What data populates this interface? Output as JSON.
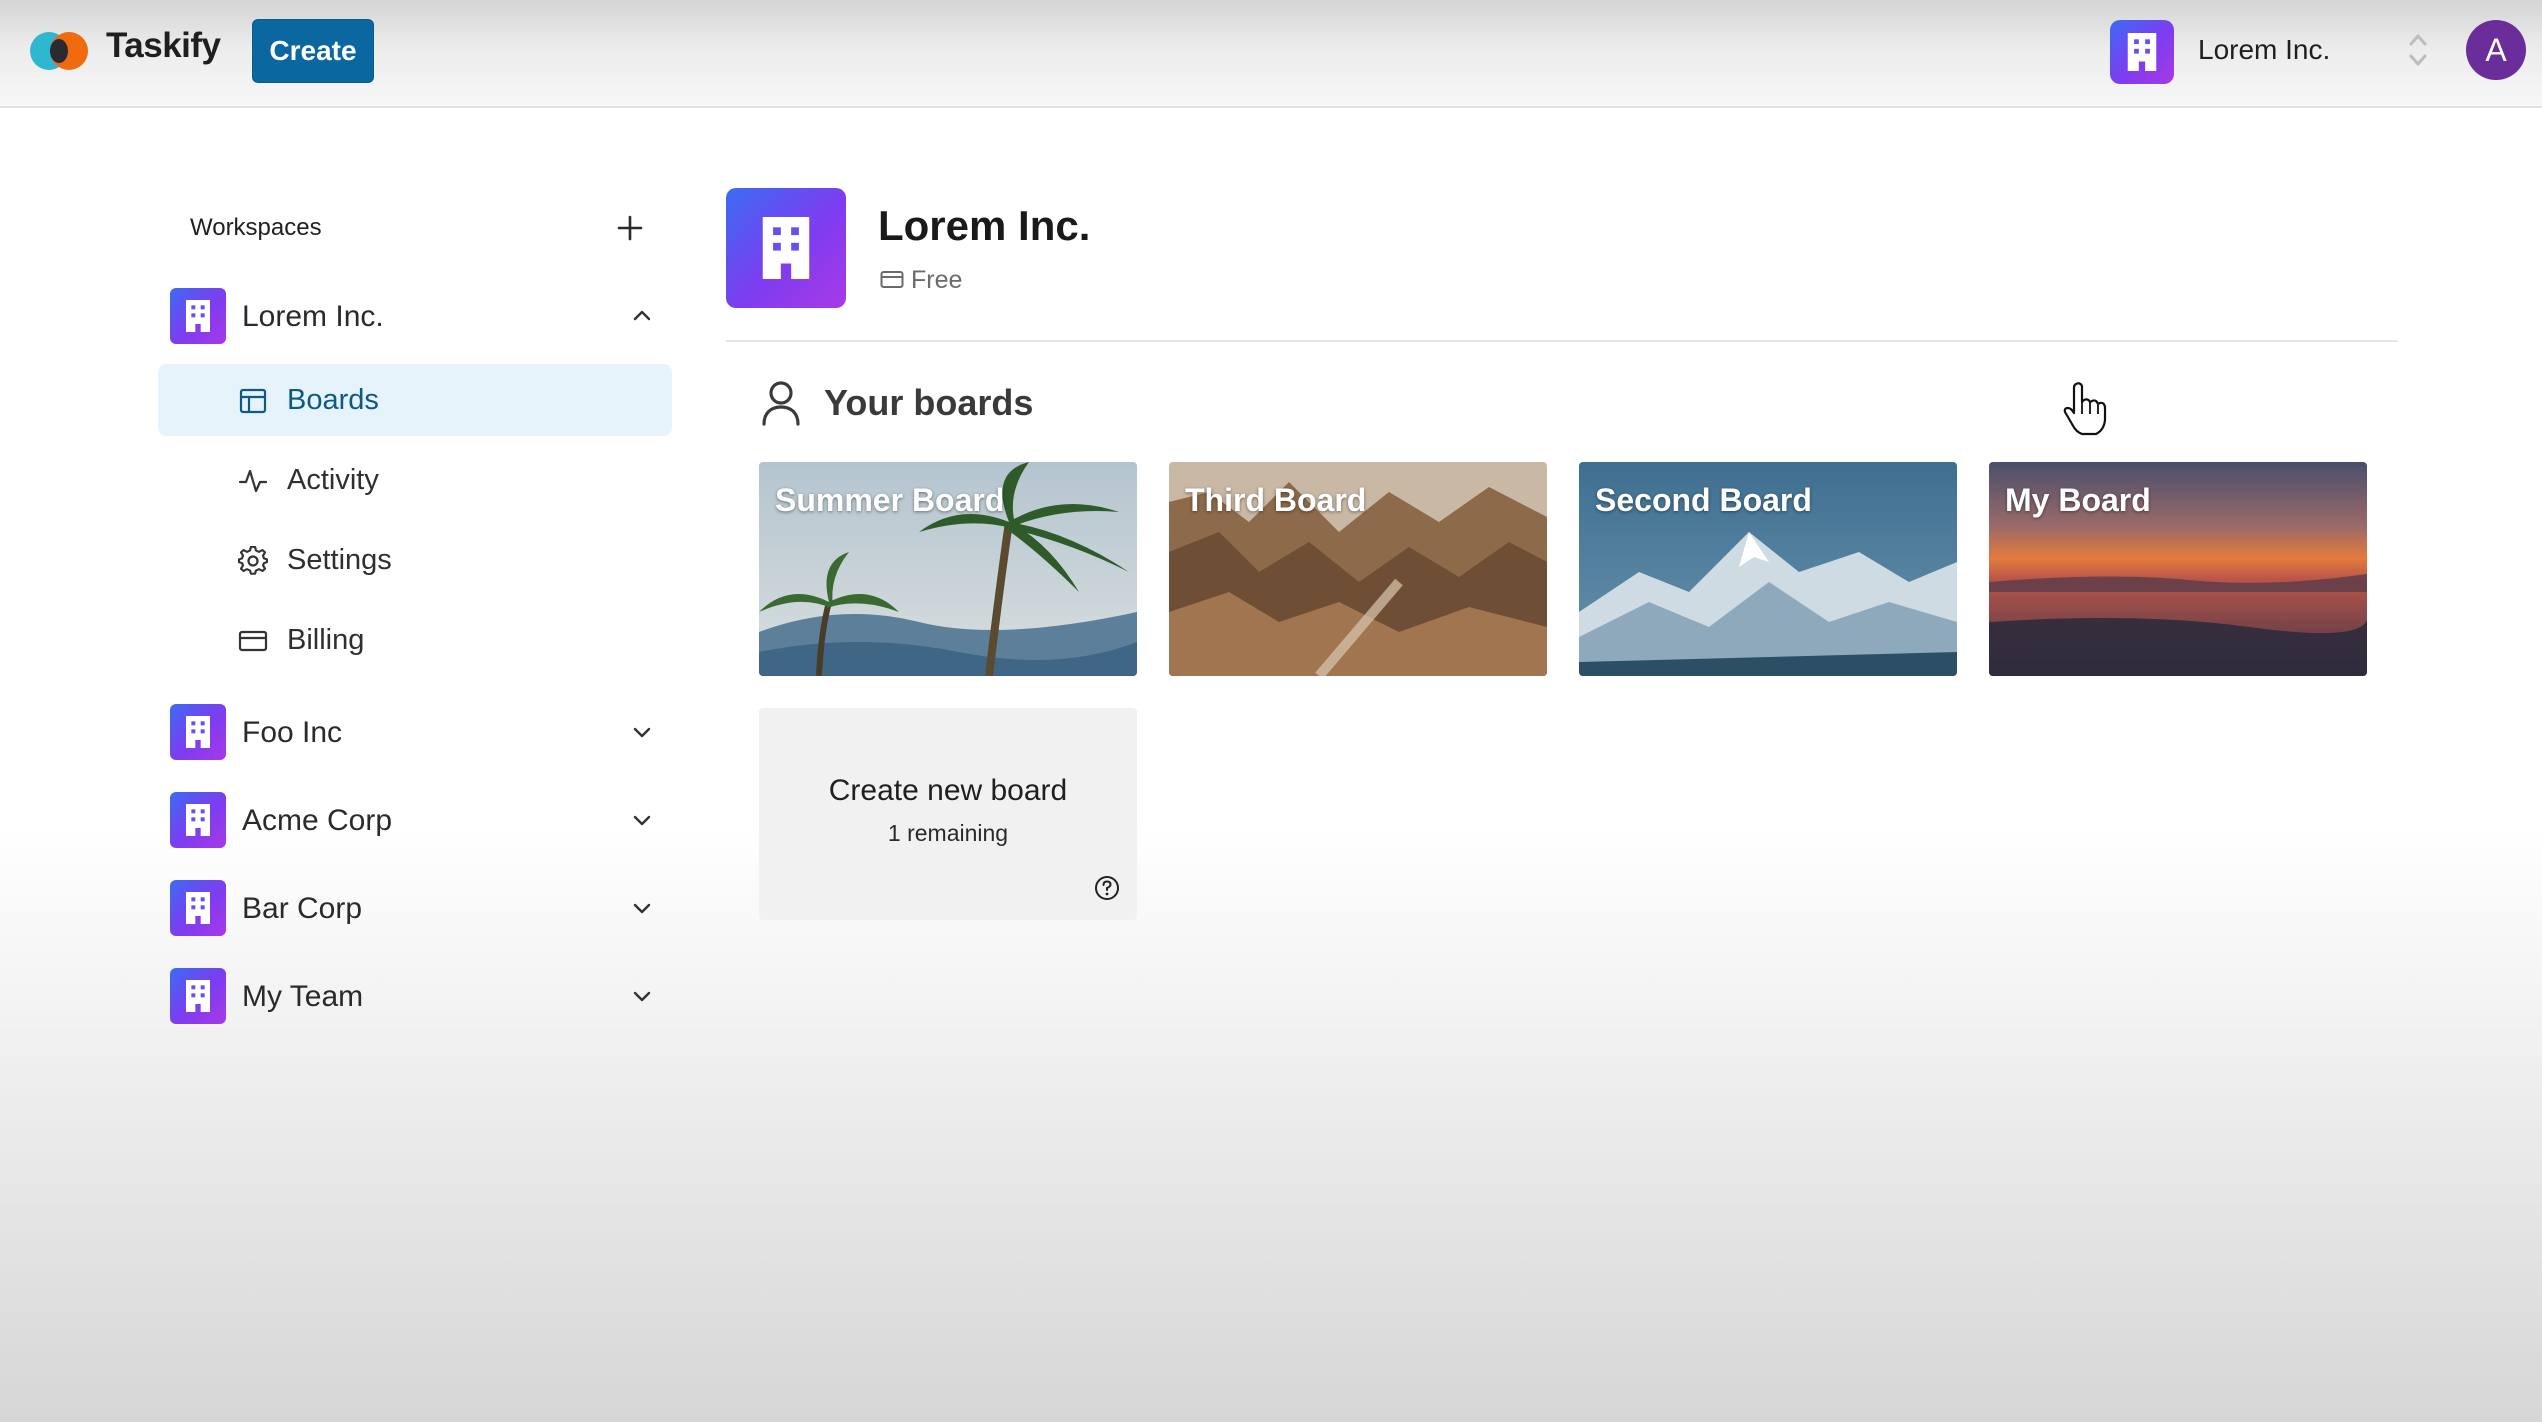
{
  "header": {
    "brand": "Taskify",
    "create_label": "Create",
    "org_name": "Lorem Inc.",
    "avatar_initial": "A"
  },
  "sidebar": {
    "heading": "Workspaces",
    "workspaces": [
      {
        "label": "Lorem Inc.",
        "expanded": true
      },
      {
        "label": "Foo Inc",
        "expanded": false
      },
      {
        "label": "Acme Corp",
        "expanded": false
      },
      {
        "label": "Bar Corp",
        "expanded": false
      },
      {
        "label": "My Team",
        "expanded": false
      }
    ],
    "nav": [
      {
        "label": "Boards",
        "icon": "layout-icon",
        "active": true
      },
      {
        "label": "Activity",
        "icon": "activity-icon",
        "active": false
      },
      {
        "label": "Settings",
        "icon": "gear-icon",
        "active": false
      },
      {
        "label": "Billing",
        "icon": "credit-card-icon",
        "active": false
      }
    ]
  },
  "main": {
    "org_title": "Lorem Inc.",
    "plan": "Free",
    "boards_heading": "Your boards",
    "boards": [
      {
        "title": "Summer Board",
        "scene": "palm-trees"
      },
      {
        "title": "Third Board",
        "scene": "canyon"
      },
      {
        "title": "Second Board",
        "scene": "snowy-mountains"
      },
      {
        "title": "My Board",
        "scene": "sunset-sea"
      }
    ],
    "create_card": {
      "title": "Create new board",
      "remaining": "1 remaining"
    }
  },
  "colors": {
    "accent": "#0b67a0",
    "active_nav_bg": "#e7f3fb",
    "workspace_gradient_start": "#3b6cf2",
    "workspace_gradient_end": "#a83ae6",
    "avatar": "#6b2d9a"
  }
}
